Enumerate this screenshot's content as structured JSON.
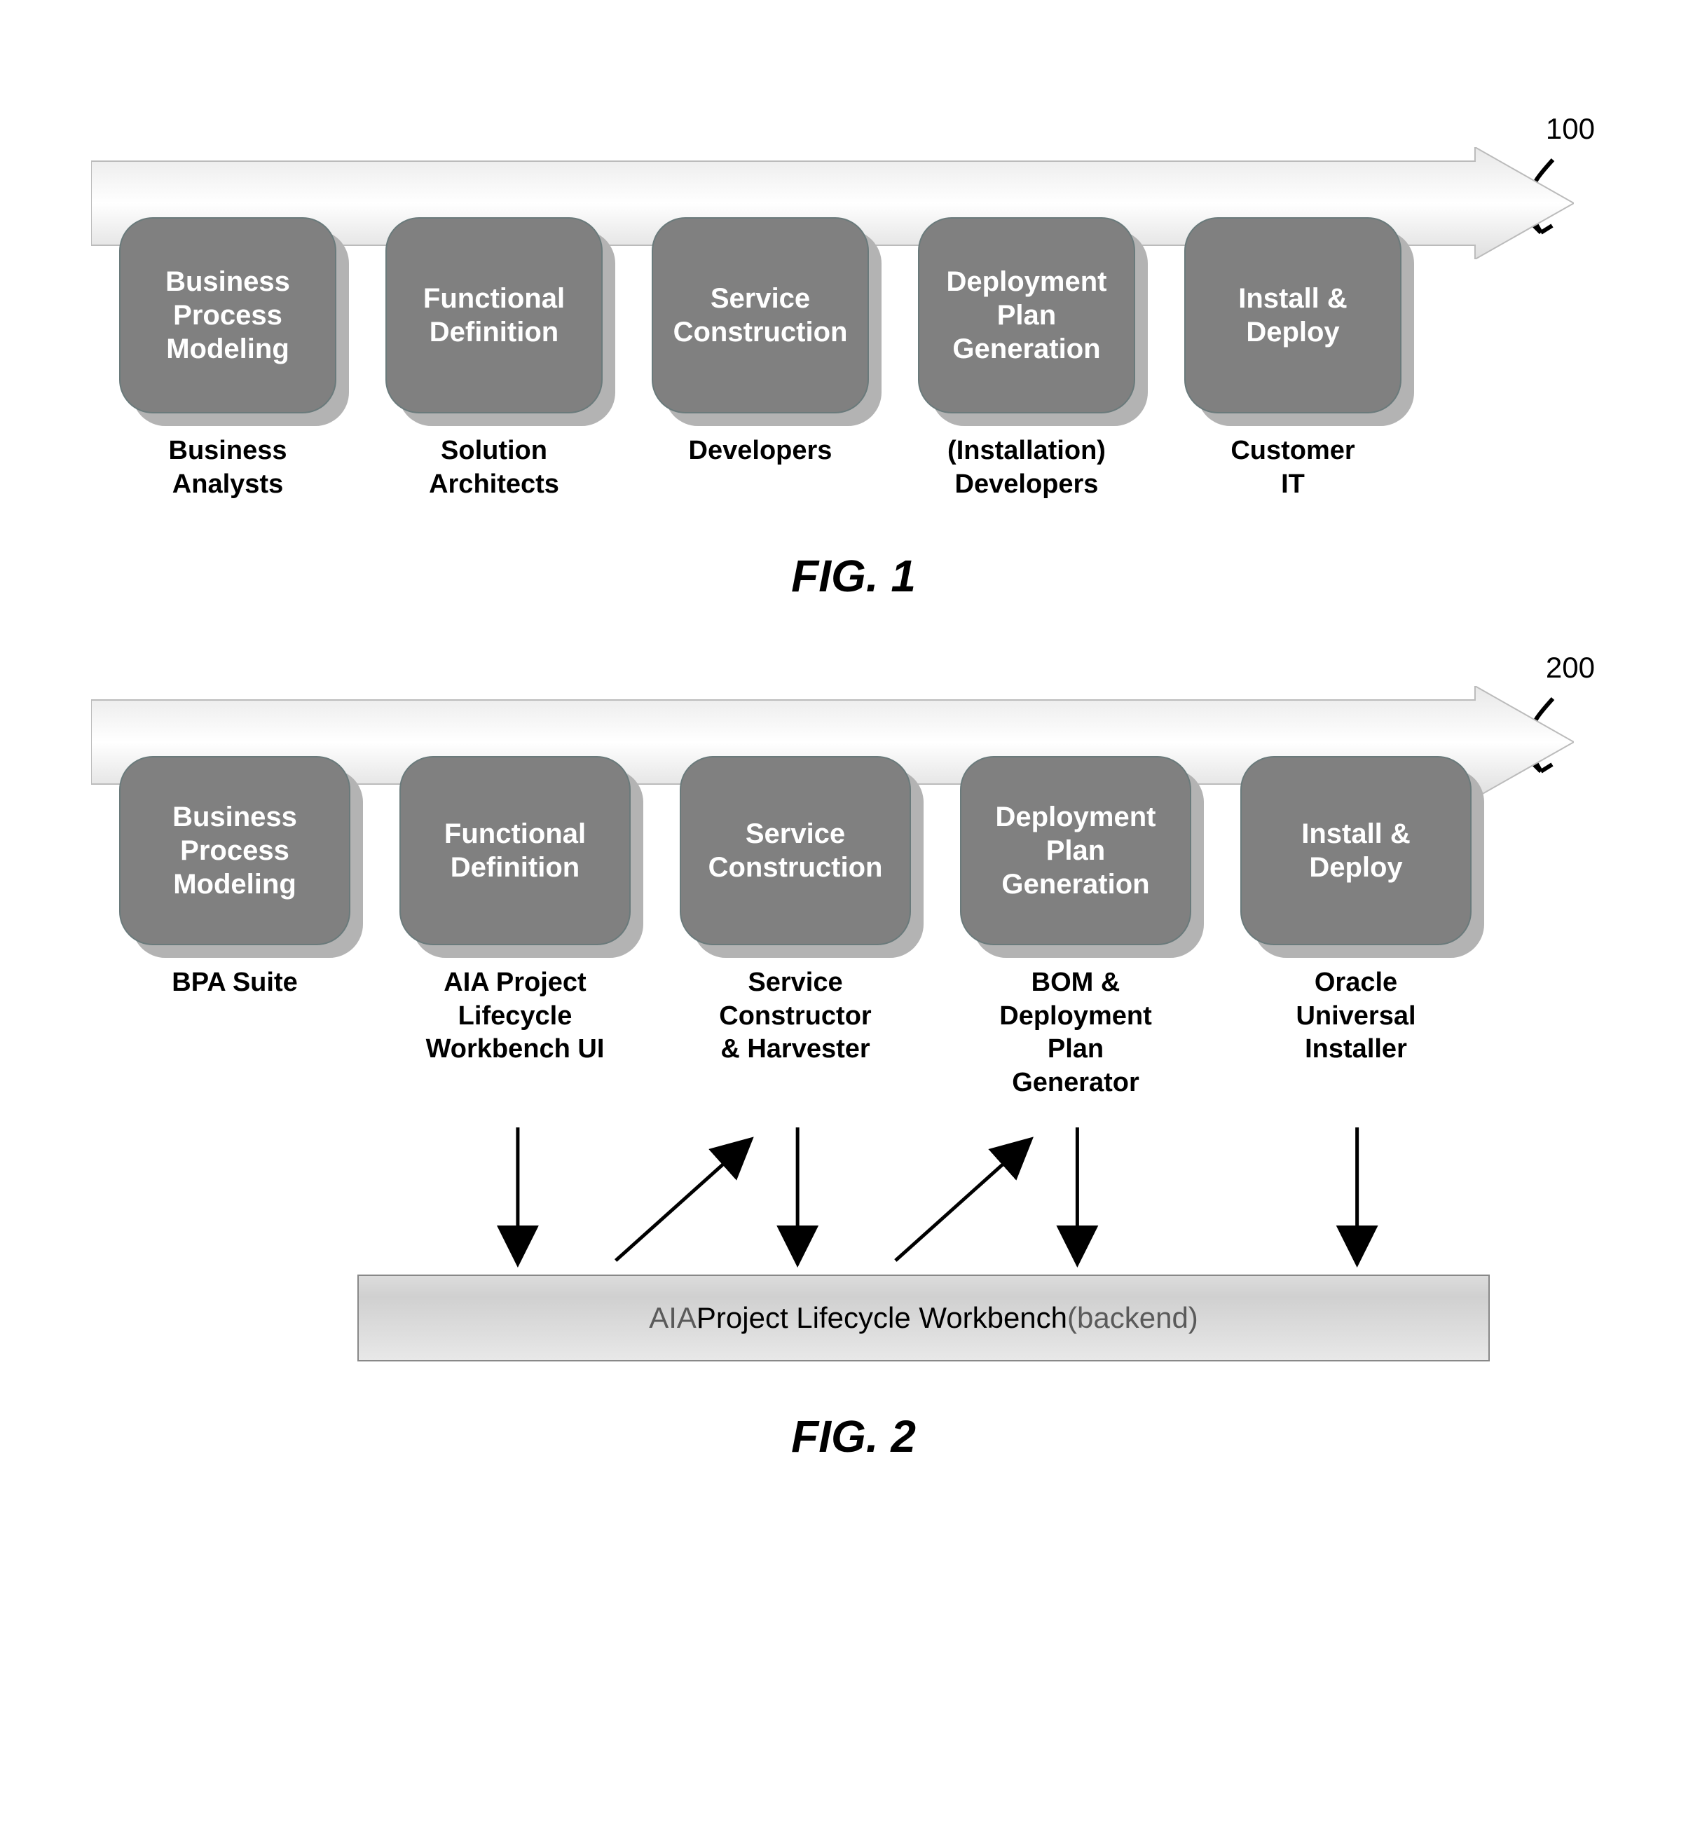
{
  "fig1": {
    "ref": "100",
    "boxes": [
      {
        "title": "Business\nProcess\nModeling",
        "caption": "Business\nAnalysts"
      },
      {
        "title": "Functional\nDefinition",
        "caption": "Solution\nArchitects"
      },
      {
        "title": "Service\nConstruction",
        "caption": "Developers"
      },
      {
        "title": "Deployment\nPlan\nGeneration",
        "caption": "(Installation)\nDevelopers"
      },
      {
        "title": "Install &\nDeploy",
        "caption": "Customer\nIT"
      }
    ],
    "label": "FIG. 1"
  },
  "fig2": {
    "ref": "200",
    "boxes": [
      {
        "title": "Business\nProcess\nModeling",
        "caption": "BPA Suite"
      },
      {
        "title": "Functional\nDefinition",
        "caption": "AIA Project\nLifecycle\nWorkbench UI"
      },
      {
        "title": "Service\nConstruction",
        "caption": "Service\nConstructor\n& Harvester"
      },
      {
        "title": "Deployment\nPlan\nGeneration",
        "caption": "BOM &\nDeployment\nPlan\nGenerator"
      },
      {
        "title": "Install &\nDeploy",
        "caption": "Oracle\nUniversal\nInstaller"
      }
    ],
    "backend_prefix": "AIA ",
    "backend_emph": "Project Lifecycle Workbench",
    "backend_suffix": " (backend)",
    "label": "FIG. 2"
  }
}
